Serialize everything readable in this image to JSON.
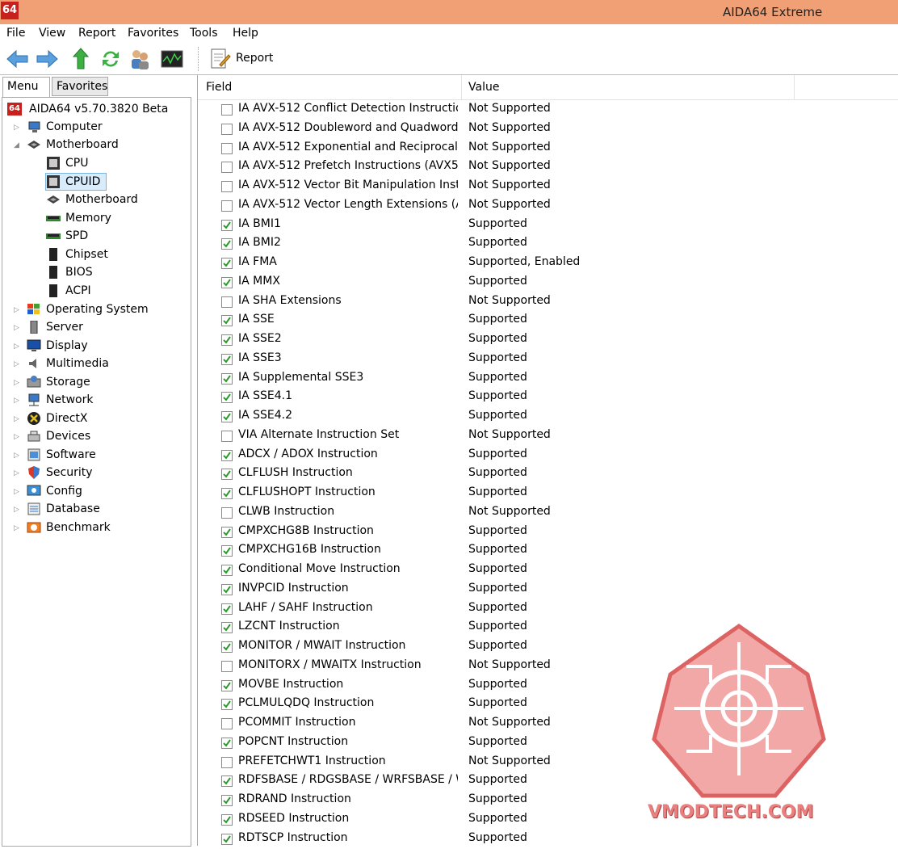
{
  "window": {
    "title": "AIDA64 Extreme",
    "app_icon_text": "64"
  },
  "menu": [
    "File",
    "View",
    "Report",
    "Favorites",
    "Tools",
    "Help"
  ],
  "toolbar": {
    "report_label": "Report"
  },
  "tabs": {
    "menu": "Menu",
    "favorites": "Favorites"
  },
  "tree": {
    "root": "AIDA64 v5.70.3820 Beta",
    "items": [
      "Computer",
      "Motherboard",
      "CPU",
      "CPUID",
      "Motherboard",
      "Memory",
      "SPD",
      "Chipset",
      "BIOS",
      "ACPI",
      "Operating System",
      "Server",
      "Display",
      "Multimedia",
      "Storage",
      "Network",
      "DirectX",
      "Devices",
      "Software",
      "Security",
      "Config",
      "Database",
      "Benchmark"
    ]
  },
  "table": {
    "headers": {
      "field": "Field",
      "value": "Value"
    },
    "rows": [
      {
        "field": "IA AVX-512 Conflict Detection Instructio...",
        "value": "Not Supported",
        "checked": false
      },
      {
        "field": "IA AVX-512 Doubleword and Quadword...",
        "value": "Not Supported",
        "checked": false
      },
      {
        "field": "IA AVX-512 Exponential and Reciprocal I...",
        "value": "Not Supported",
        "checked": false
      },
      {
        "field": "IA AVX-512 Prefetch Instructions (AVX5...",
        "value": "Not Supported",
        "checked": false
      },
      {
        "field": "IA AVX-512 Vector Bit Manipulation Inst...",
        "value": "Not Supported",
        "checked": false
      },
      {
        "field": "IA AVX-512 Vector Length Extensions (A...",
        "value": "Not Supported",
        "checked": false
      },
      {
        "field": "IA BMI1",
        "value": "Supported",
        "checked": true
      },
      {
        "field": "IA BMI2",
        "value": "Supported",
        "checked": true
      },
      {
        "field": "IA FMA",
        "value": "Supported, Enabled",
        "checked": true
      },
      {
        "field": "IA MMX",
        "value": "Supported",
        "checked": true
      },
      {
        "field": "IA SHA Extensions",
        "value": "Not Supported",
        "checked": false
      },
      {
        "field": "IA SSE",
        "value": "Supported",
        "checked": true
      },
      {
        "field": "IA SSE2",
        "value": "Supported",
        "checked": true
      },
      {
        "field": "IA SSE3",
        "value": "Supported",
        "checked": true
      },
      {
        "field": "IA Supplemental SSE3",
        "value": "Supported",
        "checked": true
      },
      {
        "field": "IA SSE4.1",
        "value": "Supported",
        "checked": true
      },
      {
        "field": "IA SSE4.2",
        "value": "Supported",
        "checked": true
      },
      {
        "field": "VIA Alternate Instruction Set",
        "value": "Not Supported",
        "checked": false
      },
      {
        "field": "ADCX / ADOX Instruction",
        "value": "Supported",
        "checked": true
      },
      {
        "field": "CLFLUSH Instruction",
        "value": "Supported",
        "checked": true
      },
      {
        "field": "CLFLUSHOPT Instruction",
        "value": "Supported",
        "checked": true
      },
      {
        "field": "CLWB Instruction",
        "value": "Not Supported",
        "checked": false
      },
      {
        "field": "CMPXCHG8B Instruction",
        "value": "Supported",
        "checked": true
      },
      {
        "field": "CMPXCHG16B Instruction",
        "value": "Supported",
        "checked": true
      },
      {
        "field": "Conditional Move Instruction",
        "value": "Supported",
        "checked": true
      },
      {
        "field": "INVPCID Instruction",
        "value": "Supported",
        "checked": true
      },
      {
        "field": "LAHF / SAHF Instruction",
        "value": "Supported",
        "checked": true
      },
      {
        "field": "LZCNT Instruction",
        "value": "Supported",
        "checked": true
      },
      {
        "field": "MONITOR / MWAIT Instruction",
        "value": "Supported",
        "checked": true
      },
      {
        "field": "MONITORX / MWAITX Instruction",
        "value": "Not Supported",
        "checked": false
      },
      {
        "field": "MOVBE Instruction",
        "value": "Supported",
        "checked": true
      },
      {
        "field": "PCLMULQDQ Instruction",
        "value": "Supported",
        "checked": true
      },
      {
        "field": "PCOMMIT Instruction",
        "value": "Not Supported",
        "checked": false
      },
      {
        "field": "POPCNT Instruction",
        "value": "Supported",
        "checked": true
      },
      {
        "field": "PREFETCHWT1 Instruction",
        "value": "Not Supported",
        "checked": false
      },
      {
        "field": "RDFSBASE / RDGSBASE / WRFSBASE / W...",
        "value": "Supported",
        "checked": true
      },
      {
        "field": "RDRAND Instruction",
        "value": "Supported",
        "checked": true
      },
      {
        "field": "RDSEED Instruction",
        "value": "Supported",
        "checked": true
      },
      {
        "field": "RDTSCP Instruction",
        "value": "Supported",
        "checked": true
      }
    ]
  },
  "watermark": {
    "text": "VMODTECH.COM"
  },
  "colors": {
    "titlebar": "#f0a074",
    "accent_red": "#c8201c",
    "check_green": "#2c9a2c",
    "selection": "#d9ecfb"
  }
}
